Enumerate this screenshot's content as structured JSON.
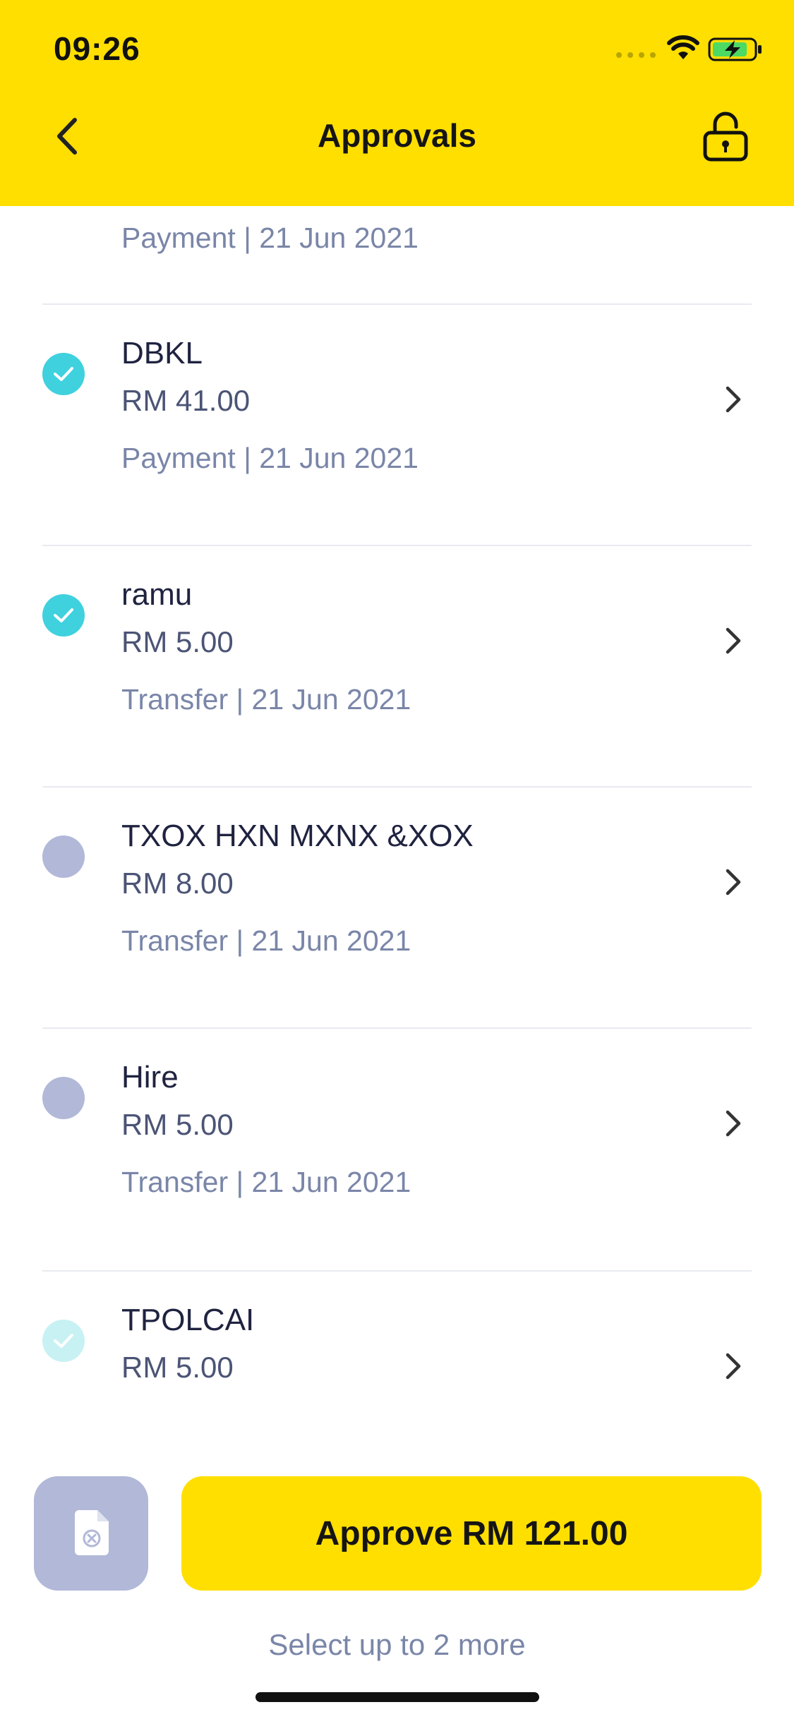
{
  "status_bar": {
    "time": "09:26"
  },
  "header": {
    "title": "Approvals"
  },
  "list": {
    "partial_top_meta": "Payment | 21 Jun 2021",
    "items": [
      {
        "name": "DBKL",
        "amount": "RM 41.00",
        "meta": "Payment | 21 Jun 2021",
        "state": "selected"
      },
      {
        "name": "ramu",
        "amount": "RM 5.00",
        "meta": "Transfer | 21 Jun 2021",
        "state": "selected"
      },
      {
        "name": "TXOX HXN MXNX &XOX",
        "amount": "RM 8.00",
        "meta": "Transfer | 21 Jun 2021",
        "state": "unselected"
      },
      {
        "name": "Hire",
        "amount": "RM 5.00",
        "meta": "Transfer | 21 Jun 2021",
        "state": "unselected"
      },
      {
        "name": "TPOLCAI",
        "amount": "RM 5.00",
        "meta": "",
        "state": "faded"
      }
    ]
  },
  "footer": {
    "approve_label": "Approve RM 121.00",
    "hint": "Select up to 2 more"
  },
  "icons": {
    "back": "chevron-left-icon",
    "lock": "unlock-icon",
    "chevron": "chevron-right-icon",
    "reject": "document-cancel-icon",
    "check": "check-icon"
  },
  "colors": {
    "accent": "#ffdf00",
    "selected": "#3fd1de",
    "unselected": "#b1b8d8",
    "muted_text": "#7a86a8"
  }
}
